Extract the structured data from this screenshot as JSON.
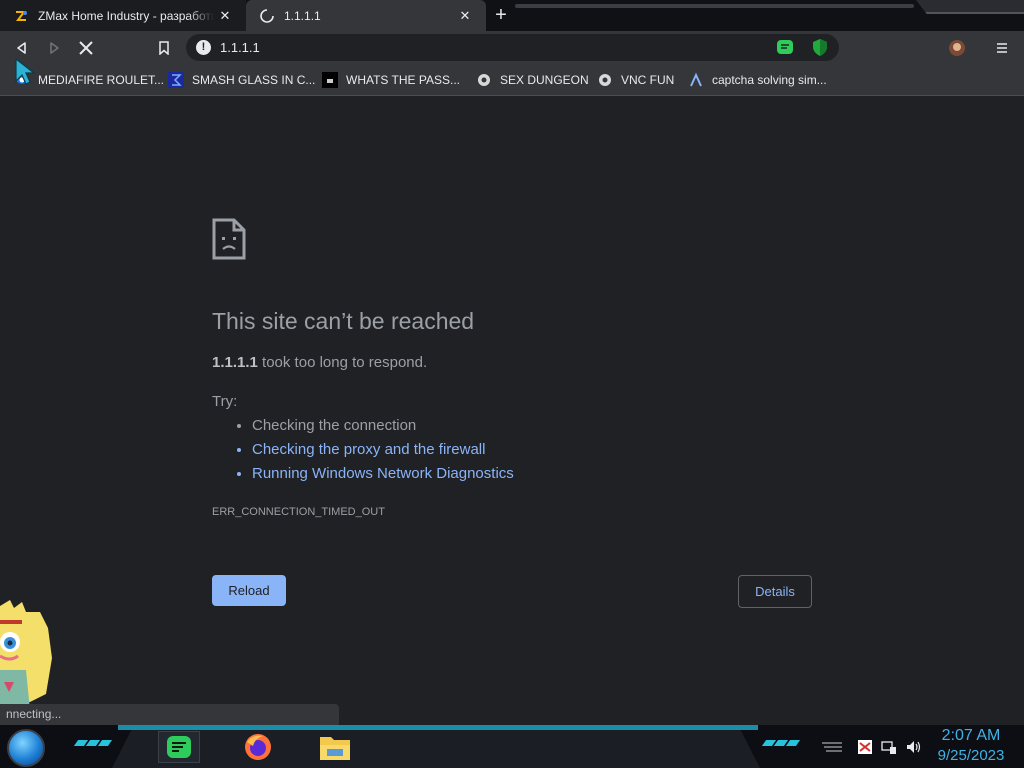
{
  "tabs": [
    {
      "title": "ZMax Home Industry - разработк",
      "close_label": "✕"
    },
    {
      "title": "1.1.1.1",
      "close_label": "✕"
    }
  ],
  "new_tab_label": "+",
  "omnibox": {
    "url": "1.1.1.1",
    "info_glyph": "!"
  },
  "bookmarks": [
    {
      "label": "MEDIAFIRE ROULET...",
      "icon": "mediafire-icon"
    },
    {
      "label": "SMASH GLASS IN C...",
      "icon": "sigma-icon"
    },
    {
      "label": "WHATS THE PASS...",
      "icon": "terminal-icon"
    },
    {
      "label": "SEX DUNGEON",
      "icon": "gear-bot-icon"
    },
    {
      "label": "VNC FUN",
      "icon": "gear-bot-icon"
    },
    {
      "label": "captcha solving sim...",
      "icon": "lambda-icon"
    }
  ],
  "error": {
    "title": "This site can’t be reached",
    "host": "1.1.1.1",
    "desc_rest": " took too long to respond.",
    "try_label": "Try:",
    "suggestions": [
      "Checking the connection",
      "Checking the proxy and the firewall",
      "Running Windows Network Diagnostics"
    ],
    "code": "ERR_CONNECTION_TIMED_OUT",
    "reload_label": "Reload",
    "details_label": "Details"
  },
  "status_text": "nnecting...",
  "clock": {
    "time": "2:07 AM",
    "date": "9/25/2023"
  },
  "colors": {
    "page_bg": "#202124",
    "link": "#8ab4f8",
    "text_muted": "#9aa0a6",
    "clock": "#3fb2e6",
    "taskbar_accent": "#27c2dc"
  }
}
